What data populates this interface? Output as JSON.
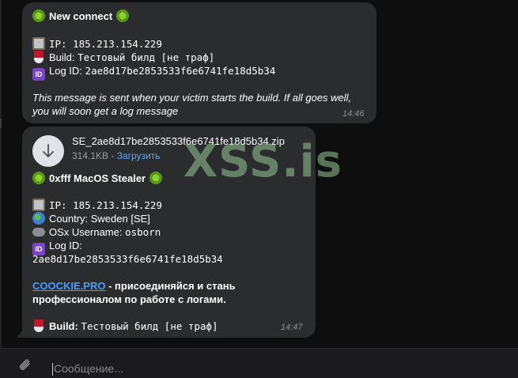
{
  "message1": {
    "title": "New connect",
    "ip": "IP: 185.213.154.229",
    "build_label": "Build:",
    "build_value": "Тестовый билд [не траф]",
    "logid_label": "Log ID:",
    "logid_value": "2ae8d17be2853533f6e6741fe18d5b34",
    "note": "This message is sent when your victim starts the build. If all goes well, you will soon get a log message",
    "time": "14:46"
  },
  "message2": {
    "file_name": "SE_2ae8d17be2853533f6e6741fe18d5b34.zip",
    "file_size": "314.1KB",
    "separator": " - ",
    "download_label": "Загрузить",
    "title": "0xfff MacOS Stealer",
    "ip": "IP: 185.213.154.229",
    "country": "Country: Sweden [SE]",
    "osx_label": "OSx Username:",
    "osx_value": "osborn",
    "logid_label": "Log ID:",
    "logid_value": "2ae8d17be2853533f6e6741fe18d5b34",
    "promo_link": "COOCKIE.PRO",
    "promo_text": " - присоединяйся и стань",
    "promo_text2": "профессионалом по работе с логами.",
    "build_label": "Build:",
    "build_value": "Тестовый билд [не траф]",
    "time": "14:47"
  },
  "watermark": "XSS.is",
  "composer": {
    "placeholder": "Сообщение..."
  },
  "icons": [
    "virus-icon",
    "clipboard-icon",
    "wine-glass-icon",
    "id-icon",
    "globe-icon",
    "gamepad-icon",
    "download-arrow-icon",
    "paperclip-icon"
  ]
}
